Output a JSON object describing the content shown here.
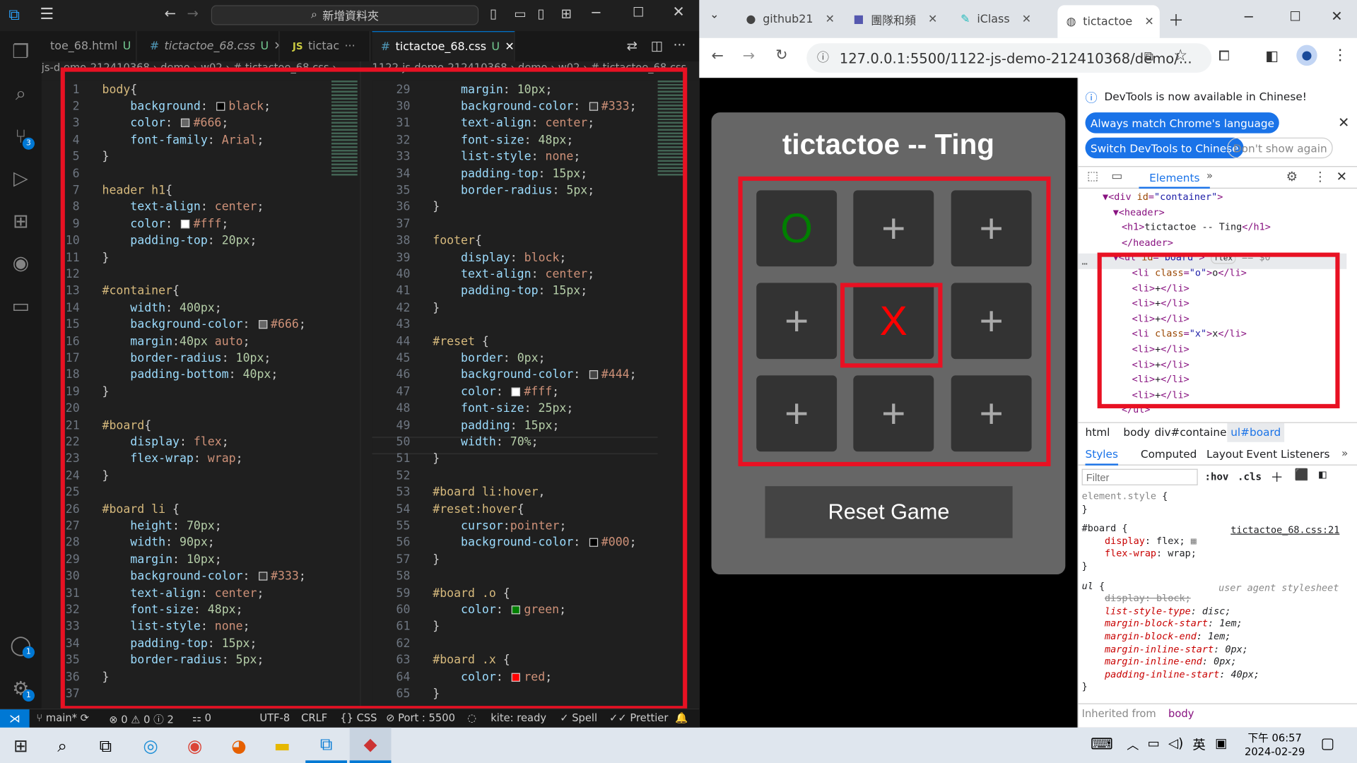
{
  "vscode": {
    "search_placeholder": "新增資料夾",
    "tabs": [
      {
        "name": "toe_68.html",
        "mod": "U",
        "kind": "html"
      },
      {
        "name": "tictactoe_68.css",
        "mod": "U",
        "kind": "css"
      },
      {
        "name": "tictac",
        "mod": "",
        "kind": "js"
      },
      {
        "name": "tictactoe_68.css",
        "mod": "U",
        "kind": "css"
      }
    ],
    "left_breadcrumb": "js-d  emo-212410368 › demo › w02 › # tictactoe_68.css › ",
    "right_breadcrumb": "1122-js-demo-212410368 › demo › w02 › # tictactoe_68.css",
    "left_lines": [
      {
        "n": "1",
        "html": "<span class='sel'>body</span><span class='pun'>{</span>"
      },
      {
        "n": "2",
        "html": "    <span class='prop'>background</span><span class='pun'>: </span><i class='sw' style='background:#000'></i><span class='val'>black</span><span class='pun'>;</span>"
      },
      {
        "n": "3",
        "html": "    <span class='prop'>color</span><span class='pun'>: </span><i class='sw' style='background:#666'></i><span class='val'>#666</span><span class='pun'>;</span>"
      },
      {
        "n": "4",
        "html": "    <span class='prop'>font-family</span><span class='pun'>: </span><span class='val'>Arial</span><span class='pun'>;</span>"
      },
      {
        "n": "5",
        "html": "<span class='pun'>}</span>"
      },
      {
        "n": "6",
        "html": ""
      },
      {
        "n": "7",
        "html": "<span class='sel'>header h1</span><span class='pun'>{</span>"
      },
      {
        "n": "8",
        "html": "    <span class='prop'>text-align</span><span class='pun'>: </span><span class='val'>center</span><span class='pun'>;</span>"
      },
      {
        "n": "9",
        "html": "    <span class='prop'>color</span><span class='pun'>: </span><i class='sw' style='background:#fff'></i><span class='val'>#fff</span><span class='pun'>;</span>"
      },
      {
        "n": "10",
        "html": "    <span class='prop'>padding-top</span><span class='pun'>: </span><span class='num'>20px</span><span class='pun'>;</span>"
      },
      {
        "n": "11",
        "html": "<span class='pun'>}</span>"
      },
      {
        "n": "12",
        "html": ""
      },
      {
        "n": "13",
        "html": "<span class='sel'>#container</span><span class='pun'>{</span>"
      },
      {
        "n": "14",
        "html": "    <span class='prop'>width</span><span class='pun'>: </span><span class='num'>400px</span><span class='pun'>;</span>"
      },
      {
        "n": "15",
        "html": "    <span class='prop'>background-color</span><span class='pun'>: </span><i class='sw' style='background:#666'></i><span class='val'>#666</span><span class='pun'>;</span>"
      },
      {
        "n": "16",
        "html": "    <span class='prop'>margin</span><span class='pun'>:</span><span class='num'>40px</span> <span class='val'>auto</span><span class='pun'>;</span>"
      },
      {
        "n": "17",
        "html": "    <span class='prop'>border-radius</span><span class='pun'>: </span><span class='num'>10px</span><span class='pun'>;</span>"
      },
      {
        "n": "18",
        "html": "    <span class='prop'>padding-bottom</span><span class='pun'>: </span><span class='num'>40px</span><span class='pun'>;</span>"
      },
      {
        "n": "19",
        "html": "<span class='pun'>}</span>"
      },
      {
        "n": "20",
        "html": ""
      },
      {
        "n": "21",
        "html": "<span class='sel'>#board</span><span class='pun'>{</span>"
      },
      {
        "n": "22",
        "html": "    <span class='prop'>display</span><span class='pun'>: </span><span class='val'>flex</span><span class='pun'>;</span>"
      },
      {
        "n": "23",
        "html": "    <span class='prop'>flex-wrap</span><span class='pun'>: </span><span class='val'>wrap</span><span class='pun'>;</span>"
      },
      {
        "n": "24",
        "html": "<span class='pun'>}</span>"
      },
      {
        "n": "25",
        "html": ""
      },
      {
        "n": "26",
        "html": "<span class='sel'>#board li </span><span class='pun'>{</span>"
      },
      {
        "n": "27",
        "html": "    <span class='prop'>height</span><span class='pun'>: </span><span class='num'>70px</span><span class='pun'>;</span>"
      },
      {
        "n": "28",
        "html": "    <span class='prop'>width</span><span class='pun'>: </span><span class='num'>90px</span><span class='pun'>;</span>"
      },
      {
        "n": "29",
        "html": "    <span class='prop'>margin</span><span class='pun'>: </span><span class='num'>10px</span><span class='pun'>;</span>"
      },
      {
        "n": "30",
        "html": "    <span class='prop'>background-color</span><span class='pun'>: </span><i class='sw' style='background:#333'></i><span class='val'>#333</span><span class='pun'>;</span>"
      },
      {
        "n": "31",
        "html": "    <span class='prop'>text-align</span><span class='pun'>: </span><span class='val'>center</span><span class='pun'>;</span>"
      },
      {
        "n": "32",
        "html": "    <span class='prop'>font-size</span><span class='pun'>: </span><span class='num'>48px</span><span class='pun'>;</span>"
      },
      {
        "n": "33",
        "html": "    <span class='prop'>list-style</span><span class='pun'>: </span><span class='val'>none</span><span class='pun'>;</span>"
      },
      {
        "n": "34",
        "html": "    <span class='prop'>padding-top</span><span class='pun'>: </span><span class='num'>15px</span><span class='pun'>;</span>"
      },
      {
        "n": "35",
        "html": "    <span class='prop'>border-radius</span><span class='pun'>: </span><span class='num'>5px</span><span class='pun'>;</span>"
      },
      {
        "n": "36",
        "html": "<span class='pun'>}</span>"
      },
      {
        "n": "37",
        "html": ""
      }
    ],
    "right_lines": [
      {
        "n": "29",
        "html": "    <span class='prop'>margin</span><span class='pun'>: </span><span class='num'>10px</span><span class='pun'>;</span>"
      },
      {
        "n": "30",
        "html": "    <span class='prop'>background-color</span><span class='pun'>: </span><i class='sw' style='background:#333'></i><span class='val'>#333</span><span class='pun'>;</span>"
      },
      {
        "n": "31",
        "html": "    <span class='prop'>text-align</span><span class='pun'>: </span><span class='val'>center</span><span class='pun'>;</span>"
      },
      {
        "n": "32",
        "html": "    <span class='prop'>font-size</span><span class='pun'>: </span><span class='num'>48px</span><span class='pun'>;</span>"
      },
      {
        "n": "33",
        "html": "    <span class='prop'>list-style</span><span class='pun'>: </span><span class='val'>none</span><span class='pun'>;</span>"
      },
      {
        "n": "34",
        "html": "    <span class='prop'>padding-top</span><span class='pun'>: </span><span class='num'>15px</span><span class='pun'>;</span>"
      },
      {
        "n": "35",
        "html": "    <span class='prop'>border-radius</span><span class='pun'>: </span><span class='num'>5px</span><span class='pun'>;</span>"
      },
      {
        "n": "36",
        "html": "<span class='pun'>}</span>"
      },
      {
        "n": "37",
        "html": ""
      },
      {
        "n": "38",
        "html": "<span class='sel'>footer</span><span class='pun'>{</span>"
      },
      {
        "n": "39",
        "html": "    <span class='prop'>display</span><span class='pun'>: </span><span class='val'>block</span><span class='pun'>;</span>"
      },
      {
        "n": "40",
        "html": "    <span class='prop'>text-align</span><span class='pun'>: </span><span class='val'>center</span><span class='pun'>;</span>"
      },
      {
        "n": "41",
        "html": "    <span class='prop'>padding-top</span><span class='pun'>: </span><span class='num'>15px</span><span class='pun'>;</span>"
      },
      {
        "n": "42",
        "html": "<span class='pun'>}</span>"
      },
      {
        "n": "43",
        "html": ""
      },
      {
        "n": "44",
        "html": "<span class='sel'>#reset </span><span class='pun'>{</span>"
      },
      {
        "n": "45",
        "html": "    <span class='prop'>border</span><span class='pun'>: </span><span class='num'>0px</span><span class='pun'>;</span>"
      },
      {
        "n": "46",
        "html": "    <span class='prop'>background-color</span><span class='pun'>: </span><i class='sw' style='background:#444'></i><span class='val'>#444</span><span class='pun'>;</span>"
      },
      {
        "n": "47",
        "html": "    <span class='prop'>color</span><span class='pun'>: </span><i class='sw' style='background:#fff'></i><span class='val'>#fff</span><span class='pun'>;</span>"
      },
      {
        "n": "48",
        "html": "    <span class='prop'>font-size</span><span class='pun'>: </span><span class='num'>25px</span><span class='pun'>;</span>"
      },
      {
        "n": "49",
        "html": "    <span class='prop'>padding</span><span class='pun'>: </span><span class='num'>15px</span><span class='pun'>;</span>"
      },
      {
        "n": "50",
        "html": "    <span class='prop'>width</span><span class='pun'>: </span><span class='num'>70%</span><span class='pun'>;</span>"
      },
      {
        "n": "51",
        "html": "<span class='pun'>}</span>"
      },
      {
        "n": "52",
        "html": ""
      },
      {
        "n": "53",
        "html": "<span class='sel'>#board li:hover</span><span class='pun'>,</span>"
      },
      {
        "n": "54",
        "html": "<span class='sel'>#reset:hover</span><span class='pun'>{</span>"
      },
      {
        "n": "55",
        "html": "    <span class='prop'>cursor</span><span class='pun'>:</span><span class='val'>pointer</span><span class='pun'>;</span>"
      },
      {
        "n": "56",
        "html": "    <span class='prop'>background-color</span><span class='pun'>: </span><i class='sw' style='background:#000'></i><span class='val'>#000</span><span class='pun'>;</span>"
      },
      {
        "n": "57",
        "html": "<span class='pun'>}</span>"
      },
      {
        "n": "58",
        "html": ""
      },
      {
        "n": "59",
        "html": "<span class='sel'>#board .o </span><span class='pun'>{</span>"
      },
      {
        "n": "60",
        "html": "    <span class='prop'>color</span><span class='pun'>: </span><i class='sw' style='background:green'></i><span class='val'>green</span><span class='pun'>;</span>"
      },
      {
        "n": "61",
        "html": "<span class='pun'>}</span>"
      },
      {
        "n": "62",
        "html": ""
      },
      {
        "n": "63",
        "html": "<span class='sel'>#board .x </span><span class='pun'>{</span>"
      },
      {
        "n": "64",
        "html": "    <span class='prop'>color</span><span class='pun'>: </span><i class='sw' style='background:red'></i><span class='val'>red</span><span class='pun'>;</span>"
      },
      {
        "n": "65",
        "html": "<span class='pun'>}</span>"
      }
    ],
    "status": {
      "branch": "main*",
      "problems": "⊗ 0 ⚠ 0 ⓘ 2",
      "ports": "⚏ 0",
      "encoding": "UTF-8",
      "eol": "CRLF",
      "language": "{} CSS",
      "port": "Port : 5500",
      "kite": "kite: ready",
      "spell": "✓ Spell",
      "prettier": "✓✓ Prettier"
    },
    "badges": {
      "scm": "3",
      "accounts": "1",
      "settings": "1"
    }
  },
  "chrome": {
    "tabs": [
      {
        "title": "github21",
        "icon": "github-icon"
      },
      {
        "title": "團隊和頻",
        "icon": "teams-icon"
      },
      {
        "title": "iClass",
        "icon": "iclass-icon"
      },
      {
        "title": "tictactoe",
        "icon": "globe-icon"
      }
    ],
    "url": "127.0.0.1:5500/1122-js-demo-212410368/demo/..."
  },
  "page": {
    "title": "tictactoe -- Ting",
    "cells": [
      "O",
      "+",
      "+",
      "+",
      "X",
      "+",
      "+",
      "+",
      "+"
    ],
    "cell_classes": [
      "o",
      "",
      "",
      "",
      "x",
      "",
      "",
      "",
      ""
    ],
    "reset_label": "Reset Game"
  },
  "devtools": {
    "banner_text": "DevTools is now available in Chinese!",
    "btn_match": "Always match Chrome's language",
    "btn_switch": "Switch DevTools to Chinese",
    "btn_dont_show": "Don't show again",
    "tab_elements": "Elements",
    "dom_lines": [
      {
        "html": "<span>▼</span><span>&lt;div </span><span class='an'>id</span>=<span class='av'>\"container\"</span>&gt;"
      },
      {
        "html": "  <span>▼</span>&lt;header&gt;"
      },
      {
        "html": "    &lt;h1&gt;<span class='tx'>tictactoe -- Ting</span>&lt;/h1&gt;"
      },
      {
        "html": "  &lt;/header&gt;"
      },
      {
        "html": "  <span>▼</span>&lt;ul <span class='an'>id</span>=<span class='av'>\"board\"</span>&gt; <span class='tx' style='border:1px solid #ccc;border-radius:8px;font-size:9px;padding:0 3px'>flex</span> <span class='tx' style='color:#888'>== $0</span>"
      },
      {
        "html": "      &lt;li <span class='an'>class</span>=<span class='av'>\"o\"</span>&gt;<span class='tx'>o</span>&lt;/li&gt;"
      },
      {
        "html": "      &lt;li&gt;<span class='tx'>+</span>&lt;/li&gt;"
      },
      {
        "html": "      &lt;li&gt;<span class='tx'>+</span>&lt;/li&gt;"
      },
      {
        "html": "      &lt;li&gt;<span class='tx'>+</span>&lt;/li&gt;"
      },
      {
        "html": "      &lt;li <span class='an'>class</span>=<span class='av'>\"x\"</span>&gt;<span class='tx'>x</span>&lt;/li&gt;"
      },
      {
        "html": "      &lt;li&gt;<span class='tx'>+</span>&lt;/li&gt;"
      },
      {
        "html": "      &lt;li&gt;<span class='tx'>+</span>&lt;/li&gt;"
      },
      {
        "html": "      &lt;li&gt;<span class='tx'>+</span>&lt;/li&gt;"
      },
      {
        "html": "      &lt;li&gt;<span class='tx'>+</span>&lt;/li&gt;"
      },
      {
        "html": "    &lt;/ul&gt;"
      }
    ],
    "dom_crumbs": [
      "html",
      "body",
      "div#container",
      "ul#board"
    ],
    "style_tabs": [
      "Styles",
      "Computed",
      "Layout",
      "Event Listeners"
    ],
    "filter_placeholder": "Filter",
    "hov": ":hov",
    "cls": ".cls",
    "style_lines": [
      {
        "html": "<span style='color:#888'>element.style</span> {"
      },
      {
        "html": "}"
      },
      {
        "html": "#board {"
      },
      {
        "html": "    <span class='sp'>display</span>: <span class='sv'>flex;</span> <span style='color:#888'>▦</span>"
      },
      {
        "html": "    <span class='sp'>flex-wrap</span>: <span class='sv'>wrap;</span>"
      },
      {
        "html": "}"
      },
      {
        "html": "<i>ul</i> {"
      },
      {
        "html": "    <s style='color:#888'>display: block;</s>"
      },
      {
        "html": "    <i><span class='sp'>list-style-type</span>: disc;</i>"
      },
      {
        "html": "    <i><span class='sp'>margin-block-start</span>: 1em;</i>"
      },
      {
        "html": "    <i><span class='sp'>margin-block-end</span>: 1em;</i>"
      },
      {
        "html": "    <i><span class='sp'>margin-inline-start</span>: 0px;</i>"
      },
      {
        "html": "    <i><span class='sp'>margin-inline-end</span>: 0px;</i>"
      },
      {
        "html": "    <i><span class='sp'>padding-inline-start</span>: 40px;</i>"
      },
      {
        "html": "}"
      }
    ],
    "board_source": "tictactoe_68.css:21",
    "ua_source": "user agent stylesheet",
    "inherited_label": "Inherited from",
    "inherited_from": "body"
  },
  "taskbar": {
    "time": "下午 06:57",
    "date": "2024-02-29",
    "ime": "英"
  }
}
